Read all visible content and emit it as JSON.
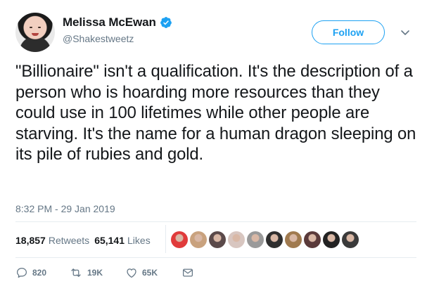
{
  "author": {
    "display_name": "Melissa McEwan",
    "handle": "@Shakestweetz"
  },
  "follow_label": "Follow",
  "tweet": {
    "text": "\"Billionaire\" isn't a qualification. It's the description of a person who is hoarding more resources than they could use in 100 lifetimes while other people are starving. It's the name for a human dragon sleeping on its pile of rubies and gold.",
    "timestamp": "8:32 PM - 29 Jan 2019"
  },
  "stats": {
    "retweets_count": "18,857",
    "retweets_label": "Retweets",
    "likes_count": "65,141",
    "likes_label": "Likes"
  },
  "liker_avatars": [
    "#e03b3b",
    "#c9a27e",
    "#5b4a4a",
    "#d8c6c0",
    "#9a9a9a",
    "#2e2e2e",
    "#a07a4f",
    "#5a3a3a",
    "#222222",
    "#3a3a3a"
  ],
  "actions": {
    "reply_count": "820",
    "retweet_count": "19K",
    "like_count": "65K"
  },
  "colors": {
    "accent": "#1da1f2",
    "secondary_text": "#657786",
    "primary_text": "#14171a"
  },
  "icons": {
    "verified": "verified-badge-icon",
    "caret": "chevron-down-icon",
    "reply": "reply-icon",
    "retweet": "retweet-icon",
    "like": "heart-icon",
    "dm": "direct-message-icon"
  }
}
